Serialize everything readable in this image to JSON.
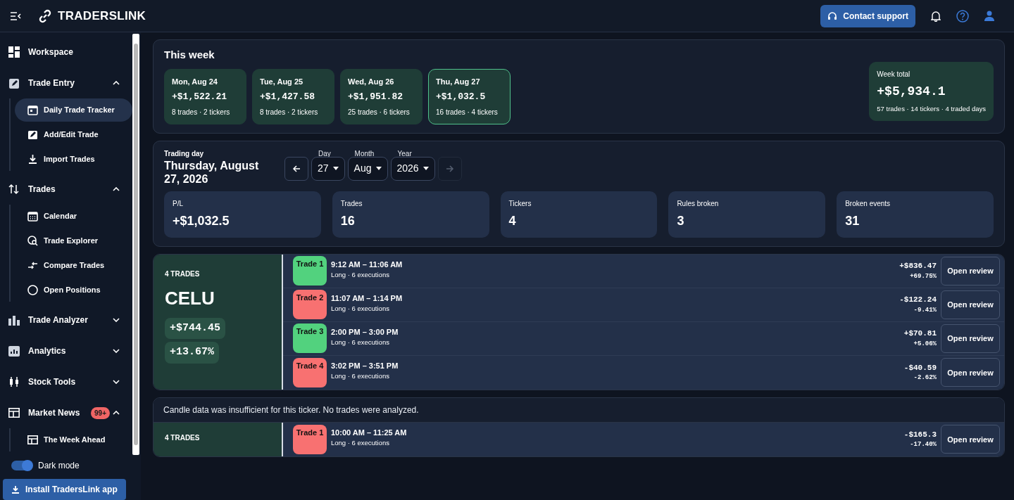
{
  "header": {
    "brand": "TRADERSLINK",
    "support_button": "Contact support"
  },
  "sidebar": {
    "items": [
      {
        "kind": "link",
        "label": "Workspace",
        "selected": false
      },
      {
        "kind": "section",
        "label": "Trade Entry",
        "expanded": true,
        "children": [
          {
            "label": "Daily Trade Tracker",
            "selected": true
          },
          {
            "label": "Add/Edit Trade",
            "selected": false
          },
          {
            "label": "Import Trades",
            "selected": false
          }
        ]
      },
      {
        "kind": "section",
        "label": "Trades",
        "expanded": true,
        "children": [
          {
            "label": "Calendar",
            "selected": false
          },
          {
            "label": "Trade Explorer",
            "selected": false
          },
          {
            "label": "Compare Trades",
            "selected": false
          },
          {
            "label": "Open Positions",
            "selected": false
          }
        ]
      },
      {
        "kind": "section",
        "label": "Trade Analyzer",
        "expanded": false
      },
      {
        "kind": "section",
        "label": "Analytics",
        "expanded": false
      },
      {
        "kind": "section",
        "label": "Stock Tools",
        "expanded": false
      },
      {
        "kind": "section",
        "label": "Market News",
        "expanded": true,
        "badge": "99+",
        "children": [
          {
            "label": "The Week Ahead",
            "selected": false
          }
        ]
      }
    ],
    "dark_mode": {
      "label": "Dark mode",
      "on": true
    },
    "install_button": "Install TradersLink app"
  },
  "week": {
    "title": "This week",
    "days": [
      {
        "date": "Mon, Aug 24",
        "pl": "+$1,522.21",
        "meta": "8 trades · 2 tickers",
        "selected": false
      },
      {
        "date": "Tue, Aug 25",
        "pl": "+$1,427.58",
        "meta": "8 trades · 2 tickers",
        "selected": false
      },
      {
        "date": "Wed, Aug 26",
        "pl": "+$1,951.82",
        "meta": "25 trades · 6 tickers",
        "selected": false
      },
      {
        "date": "Thu, Aug 27",
        "pl": "+$1,032.5",
        "meta": "16 trades · 4 tickers",
        "selected": true
      }
    ],
    "total": {
      "label": "Week total",
      "pl": "+$5,934.1",
      "meta": "57 trades · 14 tickers · 4 traded days"
    }
  },
  "trading_day": {
    "label": "Trading day",
    "date": "Thursday, August 27, 2026",
    "prev_enabled": true,
    "next_enabled": false,
    "selects": [
      {
        "label": "Day",
        "value": "27"
      },
      {
        "label": "Month",
        "value": "Aug"
      },
      {
        "label": "Year",
        "value": "2026"
      }
    ],
    "stats": [
      {
        "label": "P/L",
        "value": "+$1,032.5"
      },
      {
        "label": "Trades",
        "value": "16"
      },
      {
        "label": "Tickers",
        "value": "4"
      },
      {
        "label": "Rules broken",
        "value": "3"
      },
      {
        "label": "Broken events",
        "value": "31"
      }
    ]
  },
  "tickers": [
    {
      "count": "4 TRADES",
      "symbol": "CELU",
      "pl": "+$744.45",
      "pct": "+13.67%",
      "trades": [
        {
          "label": "Trade 1",
          "color": "#52d27e",
          "time": "9:12 AM – 11:06 AM",
          "meta": "Long · 6 executions",
          "pl": "+$836.47",
          "pct": "+69.75%",
          "button": "Open review"
        },
        {
          "label": "Trade 2",
          "color": "#f87171",
          "time": "11:07 AM – 1:14 PM",
          "meta": "Long · 6 executions",
          "pl": "-$122.24",
          "pct": "-9.41%",
          "button": "Open review"
        },
        {
          "label": "Trade 3",
          "color": "#52d27e",
          "time": "2:00 PM – 3:00 PM",
          "meta": "Long · 6 executions",
          "pl": "+$70.81",
          "pct": "+5.06%",
          "button": "Open review"
        },
        {
          "label": "Trade 4",
          "color": "#f87171",
          "time": "3:02 PM – 3:51 PM",
          "meta": "Long · 6 executions",
          "pl": "-$40.59",
          "pct": "-2.62%",
          "button": "Open review"
        }
      ]
    },
    {
      "note": "Candle data was insufficient for this ticker. No trades were analyzed.",
      "count": "4 TRADES",
      "trades": [
        {
          "label": "Trade 1",
          "color": "#f87171",
          "time": "10:00 AM – 11:25 AM",
          "meta": "Long · 6 executions",
          "pl": "-$165.3",
          "pct": "-17.40%",
          "button": "Open review"
        }
      ]
    }
  ]
}
